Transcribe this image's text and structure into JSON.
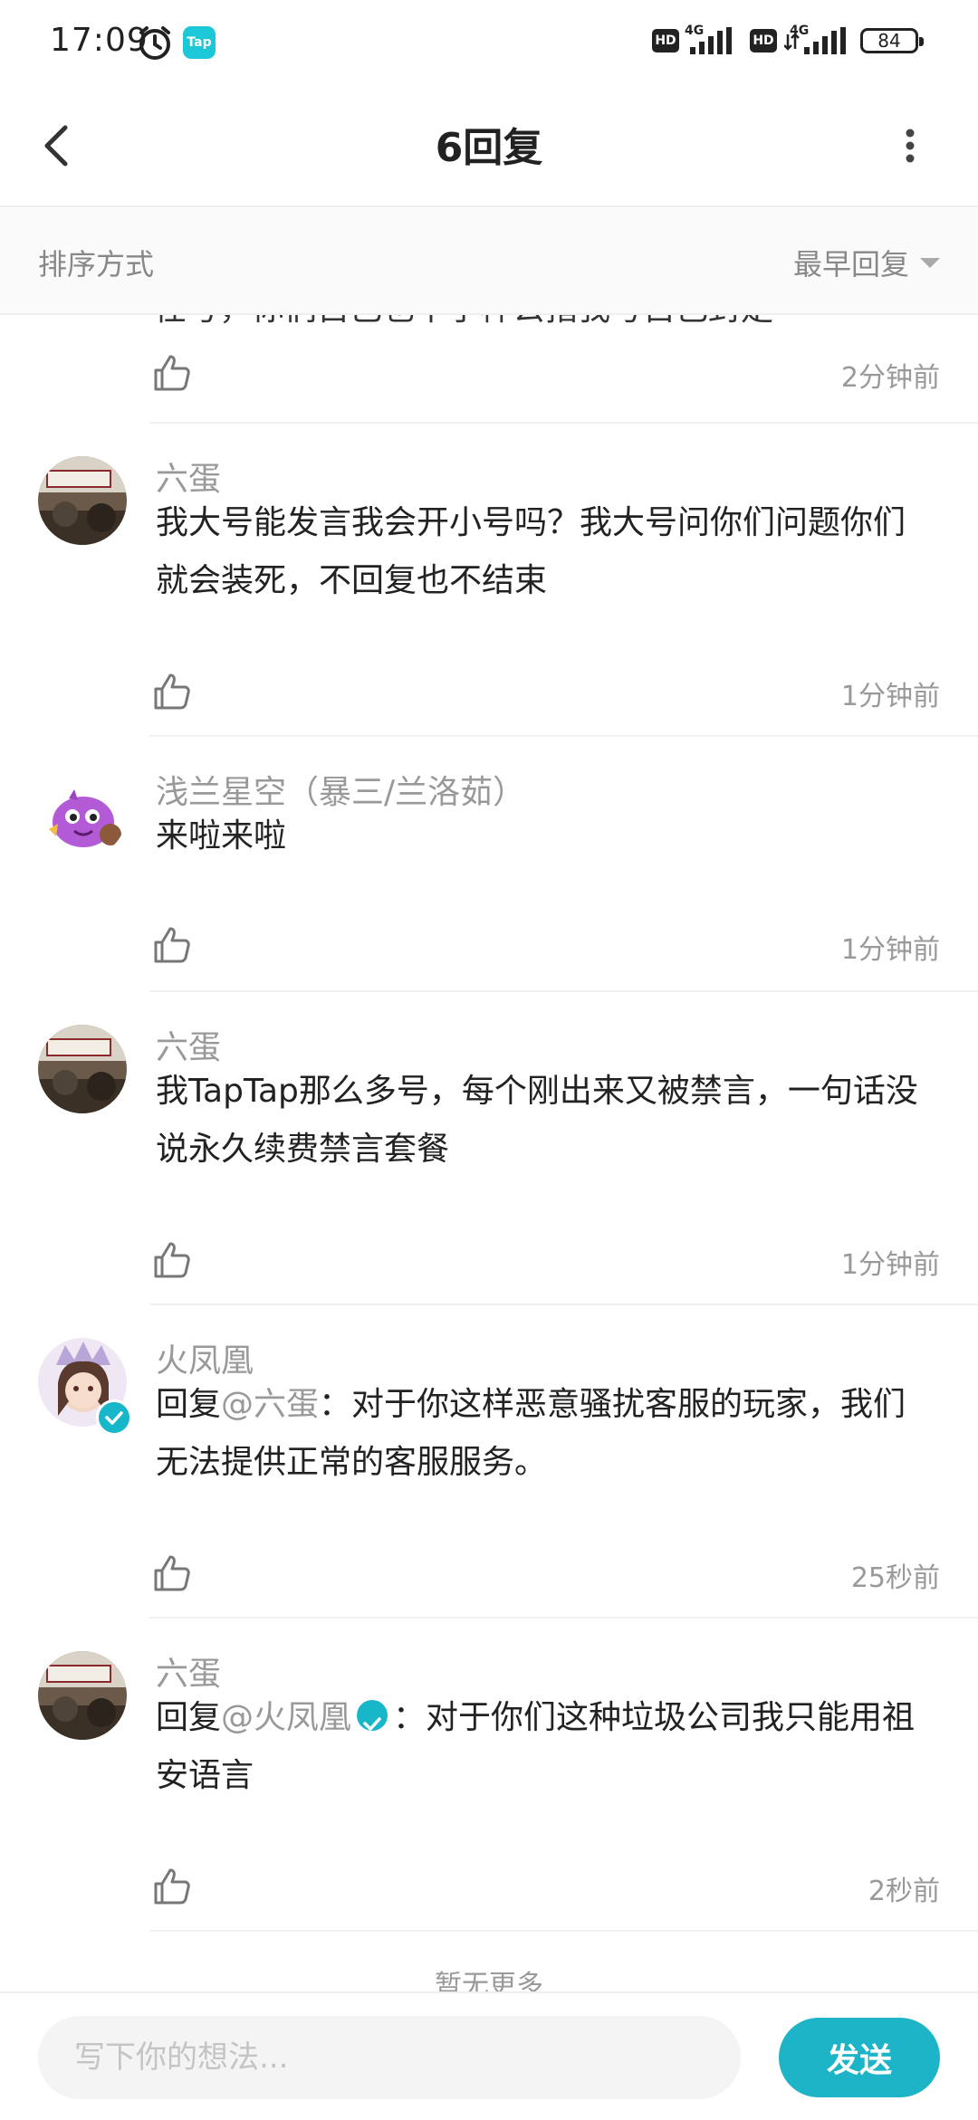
{
  "status_bar": {
    "time": "17:09",
    "app_badge": "Tap",
    "hd1": "HD",
    "net1": "4G",
    "hd2": "HD",
    "net2": "4G",
    "battery": "84"
  },
  "header": {
    "title": "6回复"
  },
  "sort": {
    "label": "排序方式",
    "selected": "最早回复"
  },
  "partial_top_text": "任号，你们自己也不了样公指我号自己封走",
  "replies": [
    {
      "time": "2分钟前"
    },
    {
      "name": "六蛋",
      "avatar": "photo-avatar",
      "content": "我大号能发言我会开小号吗？我大号问你们问题你们就会装死，不回复也不结束",
      "time": "1分钟前"
    },
    {
      "name": "浅兰星空（暴三/兰洛茹）",
      "avatar": "purple-monster-avatar",
      "content": "来啦来啦",
      "time": "1分钟前"
    },
    {
      "name": "六蛋",
      "avatar": "photo-avatar",
      "content": "我TapTap那么多号，每个刚出来又被禁言，一句话没说永久续费禁言套餐",
      "time": "1分钟前"
    },
    {
      "name": "火凤凰",
      "avatar": "anime-girl-avatar",
      "reply_prefix": "回复",
      "mention": "@六蛋",
      "content": "：对于你这样恶意骚扰客服的玩家，我们无法提供正常的客服服务。",
      "time": "25秒前"
    },
    {
      "name": "六蛋",
      "avatar": "photo-avatar",
      "reply_prefix": "回复",
      "mention": "@火凤凰",
      "content": "：对于你们这种垃圾公司我只能用祖安语言",
      "time": "2秒前"
    }
  ],
  "footer_note": "暂无更多",
  "composer": {
    "placeholder": "写下你的想法...",
    "send_label": "发送"
  },
  "colors": {
    "accent": "#1cb4c6",
    "muted_text": "#999999"
  }
}
